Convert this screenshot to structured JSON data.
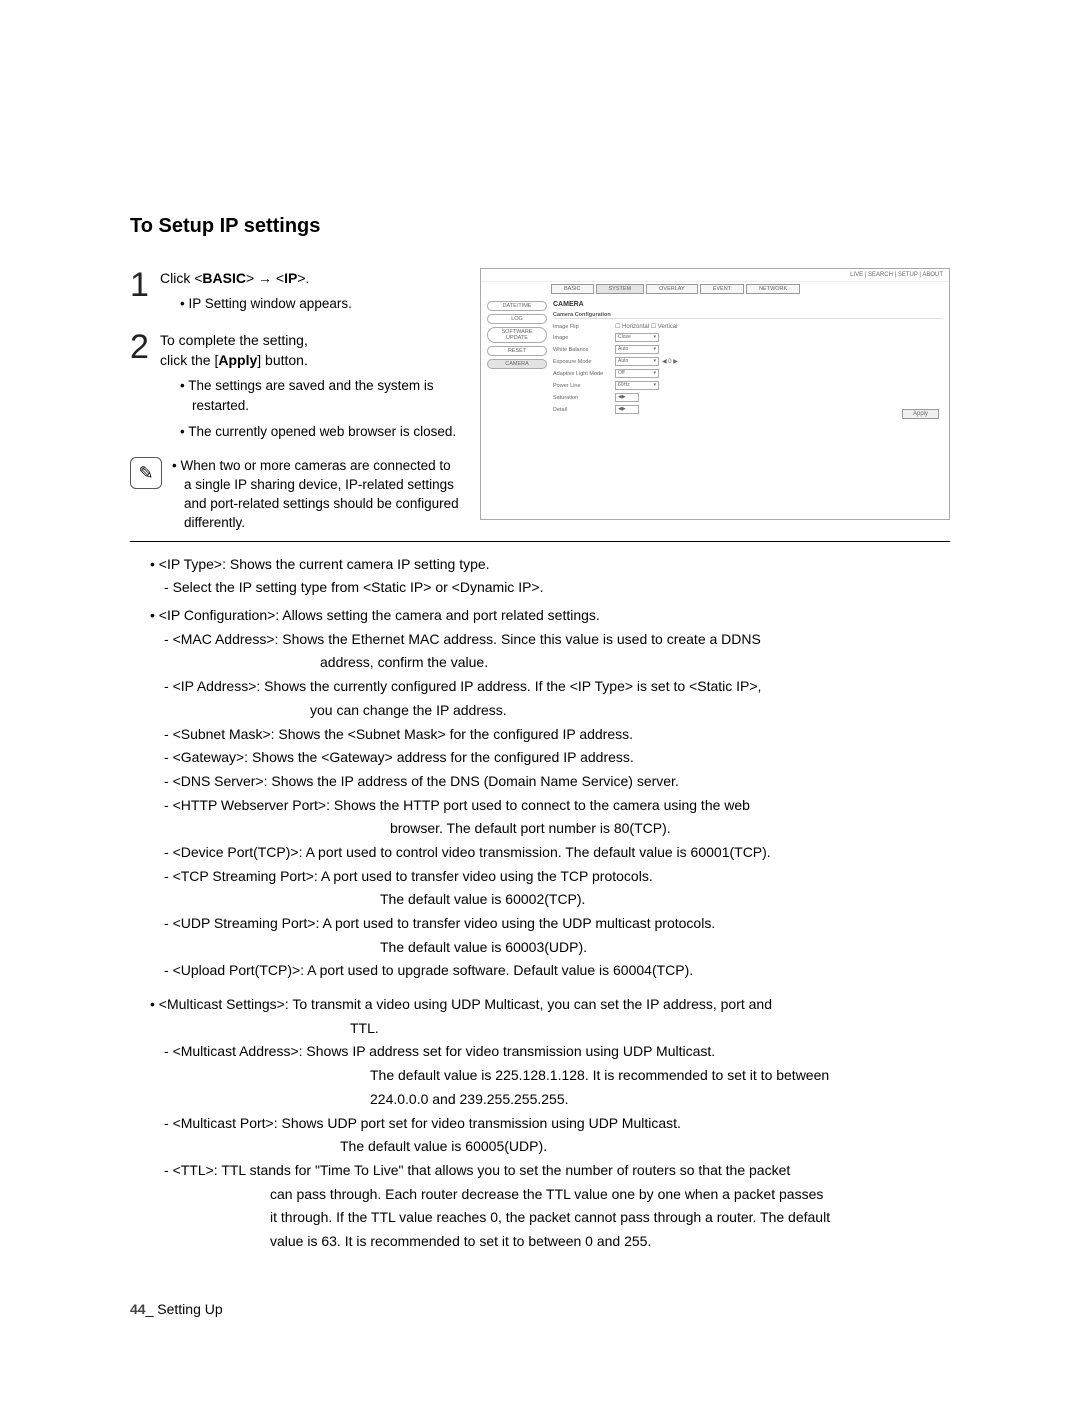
{
  "section_title": "To Setup IP settings",
  "step1": {
    "line1_a": "Click <",
    "line1_b": "BASIC",
    "line1_c": "> → <",
    "line1_d": "IP",
    "line1_e": ">.",
    "bullet1": "IP Setting window appears."
  },
  "step2": {
    "line1_a": "To complete the setting,",
    "line2_a": "click the [",
    "line2_b": "Apply",
    "line2_c": "] button.",
    "bullet1": "The settings are saved and the system is restarted.",
    "bullet2": "The currently opened web browser is closed."
  },
  "note": "When two or more cameras are connected to a single IP sharing device, IP-related settings and port-related settings should be configured differently.",
  "screenshot": {
    "top_right": "LIVE | SEARCH | SETUP | ABOUT",
    "tabs": [
      "BASIC",
      "SYSTEM",
      "OVERLAY",
      "EVENT",
      "NETWORK"
    ],
    "side": [
      "DATE/TIME",
      "LOG",
      "SOFTWARE UPDATE",
      "RESET",
      "CAMERA"
    ],
    "title": "CAMERA",
    "sub": "Camera Configuration",
    "rows": [
      {
        "label": "Image Flip",
        "ctrl": "☐ Horizontal   ☐ Vertical",
        "type": "chk"
      },
      {
        "label": "Image",
        "ctrl": "Close",
        "type": "drop"
      },
      {
        "label": "White Balance",
        "ctrl": "Auto",
        "type": "drop"
      },
      {
        "label": "Exposure Mode",
        "ctrl": "Auto",
        "type": "drop",
        "extra": "◀ 0 ▶"
      },
      {
        "label": "Adaptive Light Mode",
        "ctrl": "Off",
        "type": "drop"
      },
      {
        "label": "Power Line",
        "ctrl": "60Hz",
        "type": "drop"
      },
      {
        "label": "Saturation",
        "ctrl": "",
        "type": "spin"
      },
      {
        "label": "Detail",
        "ctrl": "",
        "type": "spin"
      }
    ],
    "apply": "Apply"
  },
  "defs": {
    "ip_type": "<IP Type>: Shows the current camera IP setting type.",
    "ip_type_sub": "Select the IP setting type from <Static IP> or <Dynamic IP>.",
    "ip_config": "<IP Configuration>: Allows setting the camera and port related settings.",
    "mac1": "<MAC Address>: Shows the Ethernet MAC address. Since this value is used to create a DDNS",
    "mac2": "address, confirm the value.",
    "ipa1": "<IP Address>: Shows the currently configured IP address. If the <IP Type> is set to <Static IP>,",
    "ipa2": "you can change the IP address.",
    "subnet": "<Subnet Mask>: Shows the <Subnet Mask> for the configured IP address.",
    "gateway": "<Gateway>: Shows the <Gateway> address for the configured IP address.",
    "dns": "<DNS Server>: Shows the IP address of the DNS (Domain Name Service) server.",
    "http1": "<HTTP Webserver Port>: Shows the HTTP port used to connect to the camera using the web",
    "http2": "browser. The default port number is 80(TCP).",
    "device": "<Device Port(TCP)>: A port used to control video transmission. The default value is 60001(TCP).",
    "tcp1": "<TCP Streaming Port>: A port used to transfer video using the TCP protocols.",
    "tcp2": "The default value is 60002(TCP).",
    "udp1": "<UDP Streaming Port>: A port used to transfer video using the UDP multicast protocols.",
    "udp2": "The default value is 60003(UDP).",
    "upload": "<Upload Port(TCP)>: A port used to upgrade software. Default value is 60004(TCP).",
    "mcast1": "<Multicast Settings>: To transmit a video using UDP Multicast, you can set the IP address, port and",
    "mcast2": "TTL.",
    "maddr1": "<Multicast Address>: Shows IP address set for video transmission using UDP Multicast.",
    "maddr2": "The default value is 225.128.1.128. It is recommended to set it to between",
    "maddr3": "224.0.0.0 and 239.255.255.255.",
    "mport1": "<Multicast Port>: Shows UDP port set for video transmission using UDP Multicast.",
    "mport2": "The default value is 60005(UDP).",
    "ttl1": "<TTL>: TTL stands for \"Time To Live\" that allows you to set the number of routers so that the packet",
    "ttl2": "can pass through. Each router decrease the TTL value one by one when a packet passes",
    "ttl3": "it through. If the TTL value reaches 0, the packet cannot pass through a router. The default",
    "ttl4": "value is 63. It is recommended to set it to between 0 and 255."
  },
  "footer": {
    "page": "44",
    "sep": "_",
    "text": " Setting Up"
  }
}
